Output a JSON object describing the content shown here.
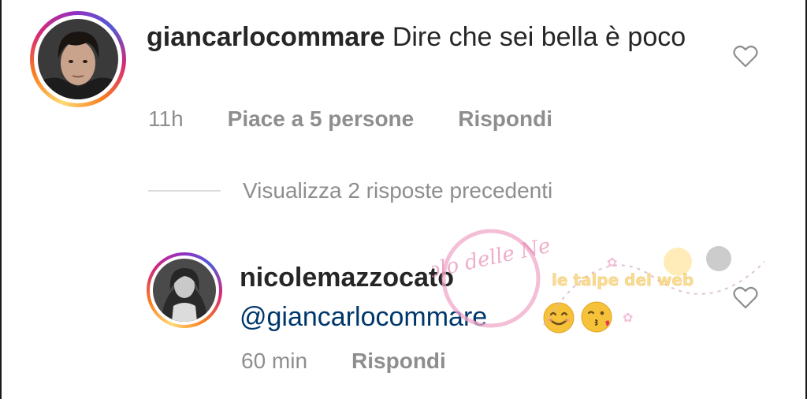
{
  "comments": [
    {
      "username": "giancarlocommare",
      "text": "Dire che sei bella è poco",
      "time": "11h",
      "likes": "Piace a 5 persone",
      "reply": "Rispondi"
    },
    {
      "username": "nicolemazzocato",
      "mention": "@giancarlocommare",
      "time": "60 min",
      "reply": "Rispondi"
    }
  ],
  "view_replies": "Visualizza 2 risposte precedenti",
  "watermarks": {
    "stamp": "Vicolo delle News",
    "banner": "le talpe del web"
  },
  "icons": {
    "like": "heart-outline-icon",
    "emoji_1": "smiling-face-emoji",
    "emoji_2": "face-blowing-kiss-emoji"
  },
  "colors": {
    "text": "#262626",
    "meta": "#8e8e8e",
    "mention": "#00376b",
    "divider": "#dbdbdb"
  }
}
